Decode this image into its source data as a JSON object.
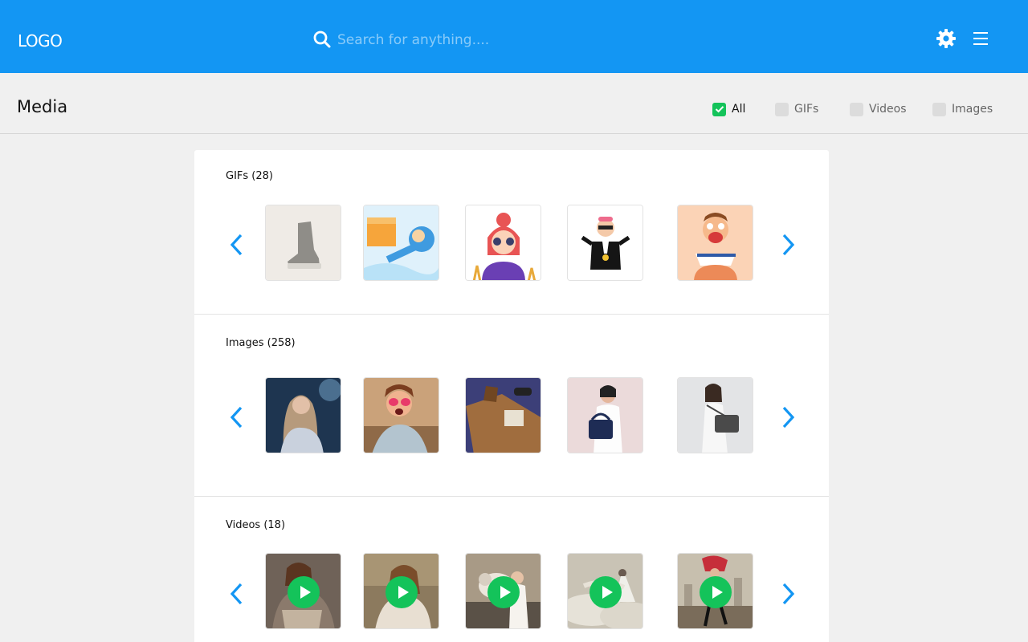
{
  "header": {
    "logo": "LOGO",
    "search_placeholder": "Search for anything....",
    "settings_icon": "gear-icon",
    "menu_icon": "hamburger-menu-icon",
    "brand_color": "#1396f3"
  },
  "page": {
    "title": "Media",
    "filters": [
      {
        "label": "All",
        "checked": true
      },
      {
        "label": "GIFs",
        "checked": false
      },
      {
        "label": "Videos",
        "checked": false
      },
      {
        "label": "Images",
        "checked": false
      }
    ],
    "check_color": "#14c35a"
  },
  "sections": [
    {
      "title": "GIFs (28)",
      "kind": "gif",
      "items": [
        "grey-sneaker-gif",
        "box-delivery-illustration-gif",
        "girl-with-glasses-illustration-gif",
        "rich-man-illustration-gif",
        "eating-boy-illustration-gif"
      ]
    },
    {
      "title": "Images (258)",
      "kind": "image",
      "items": [
        "woman-with-phone-photo",
        "girl-in-pink-sunglasses-photo",
        "leather-bag-flatlay-photo",
        "woman-with-navy-bag-photo",
        "woman-with-grey-bag-photo"
      ]
    },
    {
      "title": "Videos (18)",
      "kind": "video",
      "items": [
        "woman-in-fur-coat-video",
        "woman-in-knit-sweater-video",
        "woman-with-tiger-video",
        "woman-in-clouds-video",
        "dancer-in-street-video"
      ]
    }
  ],
  "icons": {
    "prev": "chevron-left-icon",
    "next": "chevron-right-icon",
    "play": "play-icon"
  }
}
